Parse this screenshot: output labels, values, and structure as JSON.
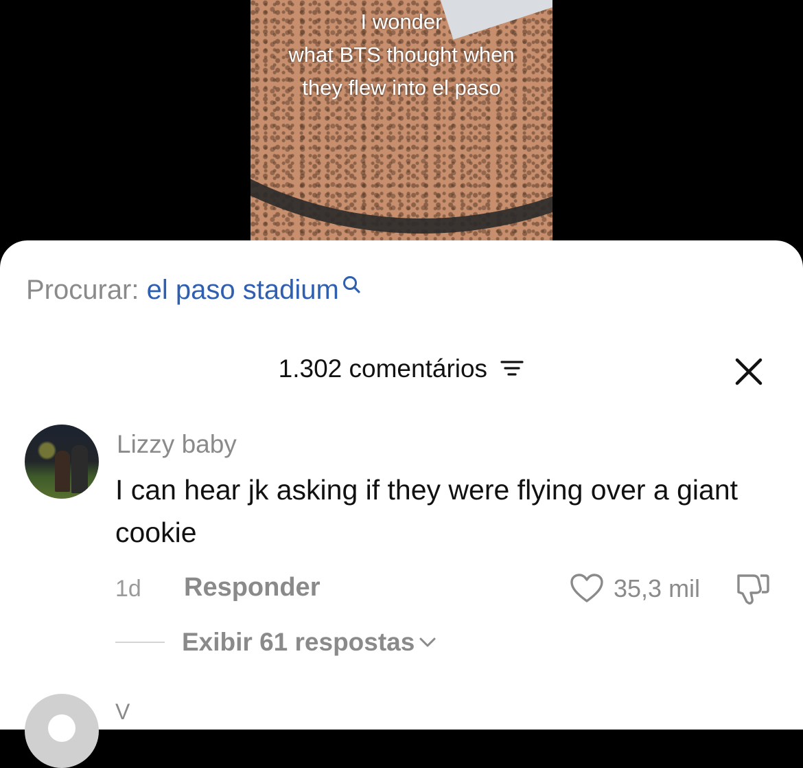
{
  "video": {
    "caption_lines": [
      "I wonder",
      "what BTS thought when",
      "they flew into el paso"
    ]
  },
  "search": {
    "label": "Procurar:",
    "term": "el paso stadium"
  },
  "comments_header": {
    "count_label": "1.302 comentários"
  },
  "comments": [
    {
      "username": "Lizzy baby",
      "text": "I can hear jk asking if they were flying over a giant cookie",
      "age": "1d",
      "reply_label": "Responder",
      "likes": "35,3 mil",
      "view_replies": "Exibir 61 respostas"
    },
    {
      "username": "V"
    }
  ],
  "colors": {
    "search_term": "#2f5fb0",
    "muted_text": "#8a8a8a",
    "primary_text": "#111111"
  }
}
